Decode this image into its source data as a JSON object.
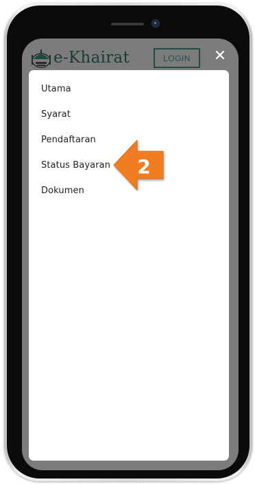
{
  "app": {
    "brand": "e-Khairat",
    "login_label": "LOGIN",
    "close_label": "✕"
  },
  "menu": {
    "items": [
      {
        "label": "Utama"
      },
      {
        "label": "Syarat"
      },
      {
        "label": "Pendaftaran"
      },
      {
        "label": "Status Bayaran"
      },
      {
        "label": "Dokumen"
      }
    ]
  },
  "annotation": {
    "step_number": "2",
    "color": "#f07d22"
  },
  "colors": {
    "brand_text": "#173b36",
    "header_bg": "#7c7c7c",
    "panel_bg": "#ffffff"
  },
  "icons": {
    "logo": "mosque-logo-icon",
    "close": "close-icon",
    "arrow": "arrow-left-icon"
  }
}
